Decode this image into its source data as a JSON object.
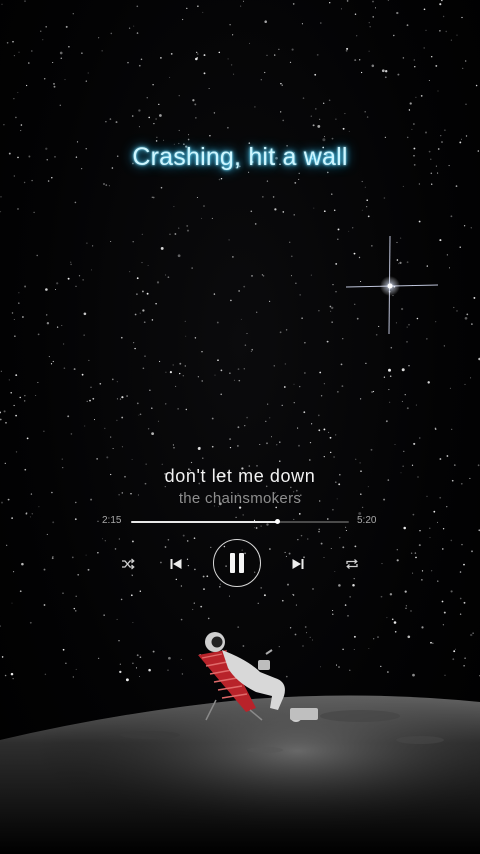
{
  "lyric": {
    "current_line": "Crashing, hit a wall"
  },
  "now_playing": {
    "title": "don't let me down",
    "artist": "the chainsmokers"
  },
  "progress": {
    "elapsed": "2:15",
    "total": "5:20",
    "fraction": 0.67
  },
  "controls": {
    "shuffle_icon": "shuffle-icon",
    "previous_icon": "skip-previous-icon",
    "play_state_icon": "pause-icon",
    "next_icon": "skip-next-icon",
    "repeat_icon": "repeat-icon"
  },
  "colors": {
    "lyric_glow": "#4fd6ff",
    "background": "#000000",
    "progress_fill": "#e8e8e8",
    "progress_track": "#4a4a4a"
  }
}
